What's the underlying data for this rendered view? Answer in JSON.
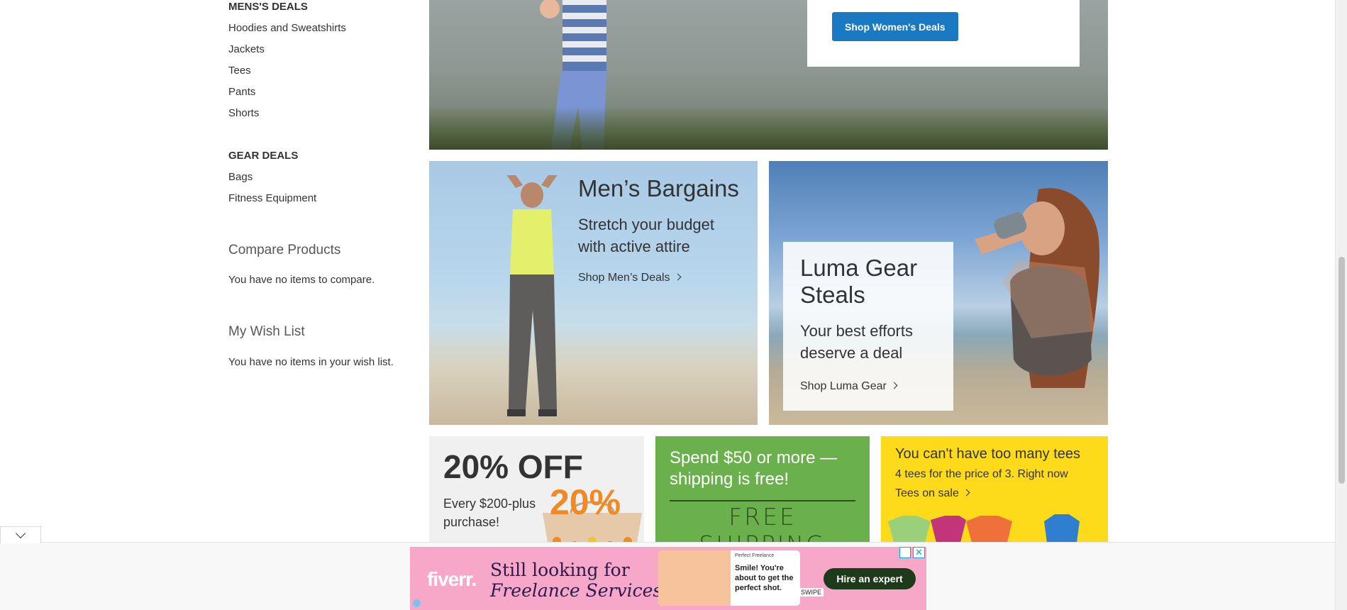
{
  "sidebar": {
    "mens_heading": "MENS'S DEALS",
    "mens_items": [
      "Hoodies and Sweatshirts",
      "Jackets",
      "Tees",
      "Pants",
      "Shorts"
    ],
    "gear_heading": "GEAR DEALS",
    "gear_items": [
      "Bags",
      "Fitness Equipment"
    ],
    "compare_title": "Compare Products",
    "compare_text": "You have no items to compare.",
    "wishlist_title": "My Wish List",
    "wishlist_text": "You have no items in your wish list."
  },
  "hero": {
    "button_label": "Shop Women's Deals"
  },
  "men_banner": {
    "title": "Men’s Bargains",
    "subtitle": "Stretch your budget with active attire",
    "link": "Shop Men’s Deals"
  },
  "gear_banner": {
    "title": "Luma Gear Steals",
    "subtitle": "Your best efforts deserve a deal",
    "link": "Shop Luma Gear"
  },
  "off_banner": {
    "headline": "20% OFF",
    "subtitle": "Every $200-plus purchase!",
    "graphic_text": "20%"
  },
  "ship_banner": {
    "text": "Spend $50 or more — shipping is free!",
    "free_label": "FREE SHIPPING"
  },
  "tees_banner": {
    "title": "You can't have too many tees",
    "subtitle": "4 tees for the price of 3. Right now",
    "link": "Tees on sale"
  },
  "ad": {
    "logo": "fiverr.",
    "line1": "Still looking for",
    "line2": "Freelance Services?",
    "card_small": "Perfect Freelance",
    "card_message": "Smile! You're about to get the perfect shot.",
    "swipe": "SWIPE",
    "cta": "Hire an expert",
    "close": "✕"
  },
  "colors": {
    "primary_button": "#1979c3",
    "shipping_green": "#6ab04c",
    "tees_yellow": "#fddb1a",
    "ad_pink": "#f7a8c9"
  }
}
